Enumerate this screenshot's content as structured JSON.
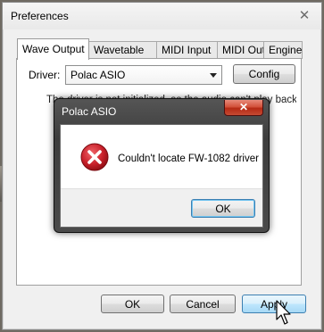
{
  "window": {
    "title": "Preferences",
    "close_glyph": "✕"
  },
  "tabs": [
    {
      "label": "Wave Output",
      "active": true
    },
    {
      "label": "Wavetable",
      "active": false
    },
    {
      "label": "MIDI Input",
      "active": false
    },
    {
      "label": "MIDI Output",
      "active": false
    },
    {
      "label": "Engine",
      "active": false
    }
  ],
  "wave_output": {
    "driver_label": "Driver:",
    "driver_value": "Polac ASIO",
    "config_label": "Config",
    "info_text": "The driver is not initialized, so the audio can't play back. OK."
  },
  "buttons": {
    "ok": "OK",
    "cancel": "Cancel",
    "apply": "Apply"
  },
  "dialog": {
    "title": "Polac ASIO",
    "close_glyph": "✕",
    "message": "Couldn't locate FW-1082 driver",
    "ok_label": "OK",
    "icon": "error-icon"
  },
  "colors": {
    "error_red": "#c8202a",
    "dialog_close_red": "#c64a33",
    "hover_blue": "#bee6fd"
  }
}
